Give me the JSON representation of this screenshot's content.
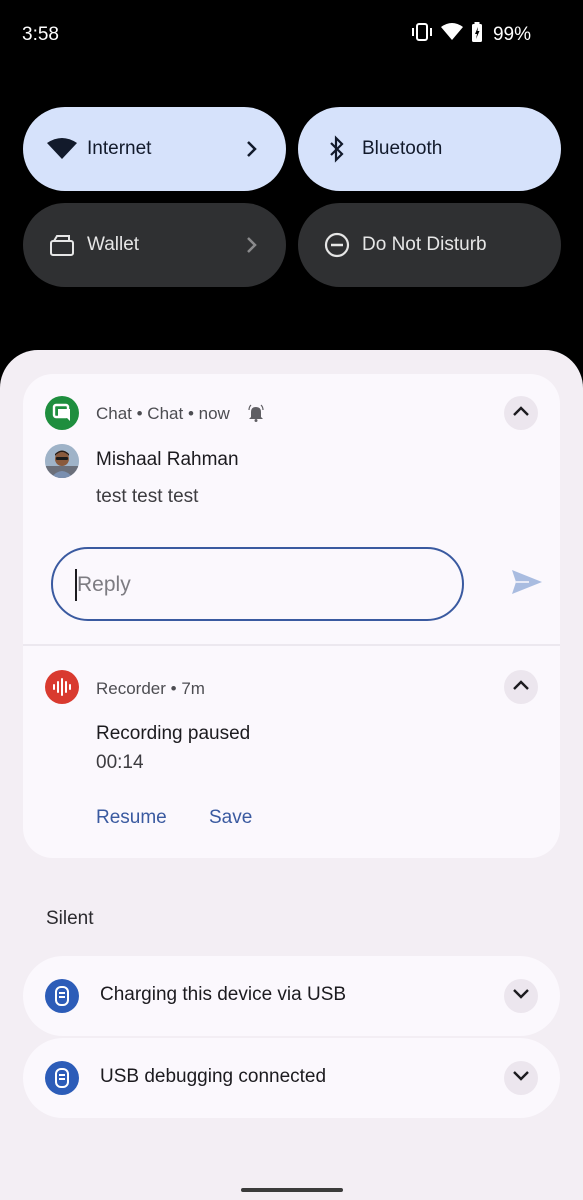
{
  "status_bar": {
    "time": "3:58",
    "battery": "99%"
  },
  "quick_settings": {
    "tiles": [
      {
        "label": "Internet",
        "icon": "wifi-icon",
        "state": "on",
        "has_chevron": true
      },
      {
        "label": "Bluetooth",
        "icon": "bluetooth-icon",
        "state": "on",
        "has_chevron": false
      },
      {
        "label": "Wallet",
        "icon": "wallet-icon",
        "state": "off",
        "has_chevron": true
      },
      {
        "label": "Do Not Disturb",
        "icon": "dnd-icon",
        "state": "off",
        "has_chevron": false
      }
    ]
  },
  "notifications": {
    "chat": {
      "meta": "Chat • Chat • now",
      "sender": "Mishaal Rahman",
      "message": "test test test",
      "reply_placeholder": "Reply"
    },
    "recorder": {
      "meta": "Recorder • 7m",
      "title": "Recording paused",
      "elapsed": "00:14",
      "actions": [
        "Resume",
        "Save"
      ]
    }
  },
  "silent_section": {
    "label": "Silent",
    "items": [
      {
        "text": "Charging this device via USB"
      },
      {
        "text": "USB debugging connected"
      }
    ]
  },
  "colors": {
    "tile_on": "#d6e2fb",
    "tile_off": "#2f3032",
    "shade": "#f3eef4",
    "accent": "#3a5aa0",
    "chat_green": "#1e8e3e",
    "recorder_red": "#d93a2f",
    "usb_blue": "#2c5cb8"
  }
}
